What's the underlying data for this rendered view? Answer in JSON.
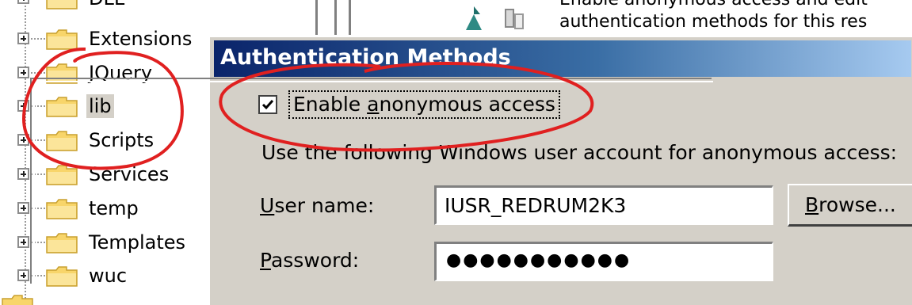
{
  "tree": {
    "items": [
      {
        "label": "DLL"
      },
      {
        "label": "Extensions"
      },
      {
        "label": "JQuery"
      },
      {
        "label": "lib",
        "selected": true
      },
      {
        "label": "Scripts"
      },
      {
        "label": "Services"
      },
      {
        "label": "temp"
      },
      {
        "label": "Templates"
      },
      {
        "label": "wuc"
      }
    ]
  },
  "background_text": {
    "line1": "Enable anonymous access and edit",
    "line2": "authentication methods for this res"
  },
  "dialog": {
    "title": "Authentication Methods",
    "anonymous": {
      "checked": true,
      "label_pre": "Enable ",
      "label_accel": "a",
      "label_post": "nonymous access"
    },
    "account_text": "Use the following Windows user account for anonymous access:",
    "user_name": {
      "label_accel": "U",
      "label_rest": "ser name:",
      "value": "IUSR_REDRUM2K3"
    },
    "browse": {
      "label_accel": "B",
      "label_rest": "rowse..."
    },
    "password": {
      "label_accel": "P",
      "label_rest": "assword:",
      "masked": "●●●●●●●●●●●"
    }
  },
  "colors": {
    "dialog_bg": "#d4d0c8",
    "title_start": "#0a246a",
    "title_end": "#a6caf0",
    "annotation": "#e02020"
  },
  "icons": [
    "folder-icon",
    "expand-plus-icon",
    "checkmark-icon"
  ]
}
